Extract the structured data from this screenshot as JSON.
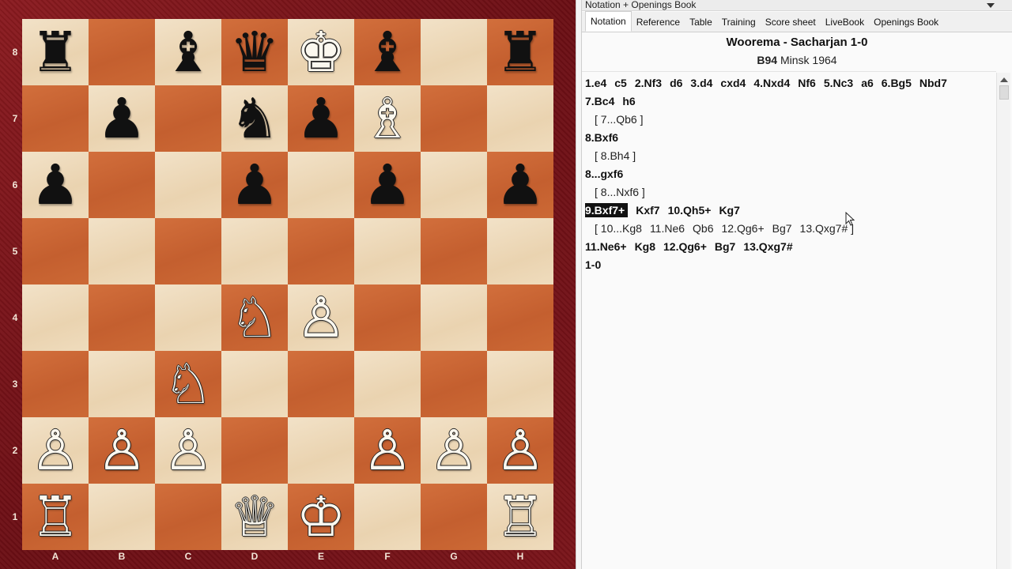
{
  "board": {
    "ranks": [
      "8",
      "7",
      "6",
      "5",
      "4",
      "3",
      "2",
      "1"
    ],
    "files": [
      "A",
      "B",
      "C",
      "D",
      "E",
      "F",
      "G",
      "H"
    ],
    "pieces": {
      "a8": "b:♜",
      "c8": "b:♝",
      "d8": "b:♛",
      "e8": "w:♚",
      "f8": "b:♝",
      "h8": "b:♜",
      "b7": "b:♟",
      "d7": "b:♞",
      "e7": "b:♟",
      "f7": "w:♗",
      "a6": "b:♟",
      "d6": "b:♟",
      "f6": "b:♟",
      "h6": "b:♟",
      "d4": "w:♘",
      "e4": "w:♙",
      "c3": "w:♘",
      "a2": "w:♙",
      "b2": "w:♙",
      "c2": "w:♙",
      "f2": "w:♙",
      "g2": "w:♙",
      "h2": "w:♙",
      "a1": "w:♖",
      "d1": "w:♕",
      "e1": "w:♔",
      "h1": "w:♖"
    }
  },
  "panel": {
    "title": "Notation + Openings Book",
    "menu_icon": "dropdown-triangle-icon",
    "close_icon": "close-icon",
    "tabs": [
      {
        "label": "Notation",
        "active": true
      },
      {
        "label": "Reference",
        "active": false
      },
      {
        "label": "Table",
        "active": false
      },
      {
        "label": "Training",
        "active": false
      },
      {
        "label": "Score sheet",
        "active": false
      },
      {
        "label": "LiveBook",
        "active": false
      },
      {
        "label": "Openings Book",
        "active": false
      }
    ]
  },
  "game": {
    "players": "Woorema - Sacharjan  1-0",
    "eco": "B94",
    "event": "Minsk 1964"
  },
  "notation": {
    "line1": [
      "1.e4",
      "c5",
      "2.Nf3",
      "d6",
      "3.d4",
      "cxd4",
      "4.Nxd4",
      "Nf6",
      "5.Nc3",
      "a6",
      "6.Bg5",
      "Nbd7"
    ],
    "line2": [
      "7.Bc4",
      "h6"
    ],
    "var1": "[ 7...Qb6 ]",
    "line3": [
      "8.Bxf6"
    ],
    "var2": "[ 8.Bh4 ]",
    "line4": [
      "8...gxf6"
    ],
    "var3": "[ 8...Nxf6 ]",
    "line5_current": "9.Bxf7+",
    "line5": [
      "Kxf7",
      "10.Qh5+",
      "Kg7"
    ],
    "var4": [
      "[ 10...Kg8",
      "11.Ne6",
      "Qb6",
      "12.Qg6+",
      "Bg7",
      "13.Qxg7# ]"
    ],
    "line6": [
      "11.Ne6+",
      "Kg8",
      "12.Qg6+",
      "Bg7",
      "13.Qxg7#"
    ],
    "result": "1-0"
  },
  "colors": {
    "light_square": "#eed9b8",
    "dark_square": "#c9652f",
    "frame": "#7a1419",
    "highlight": "#111111"
  }
}
